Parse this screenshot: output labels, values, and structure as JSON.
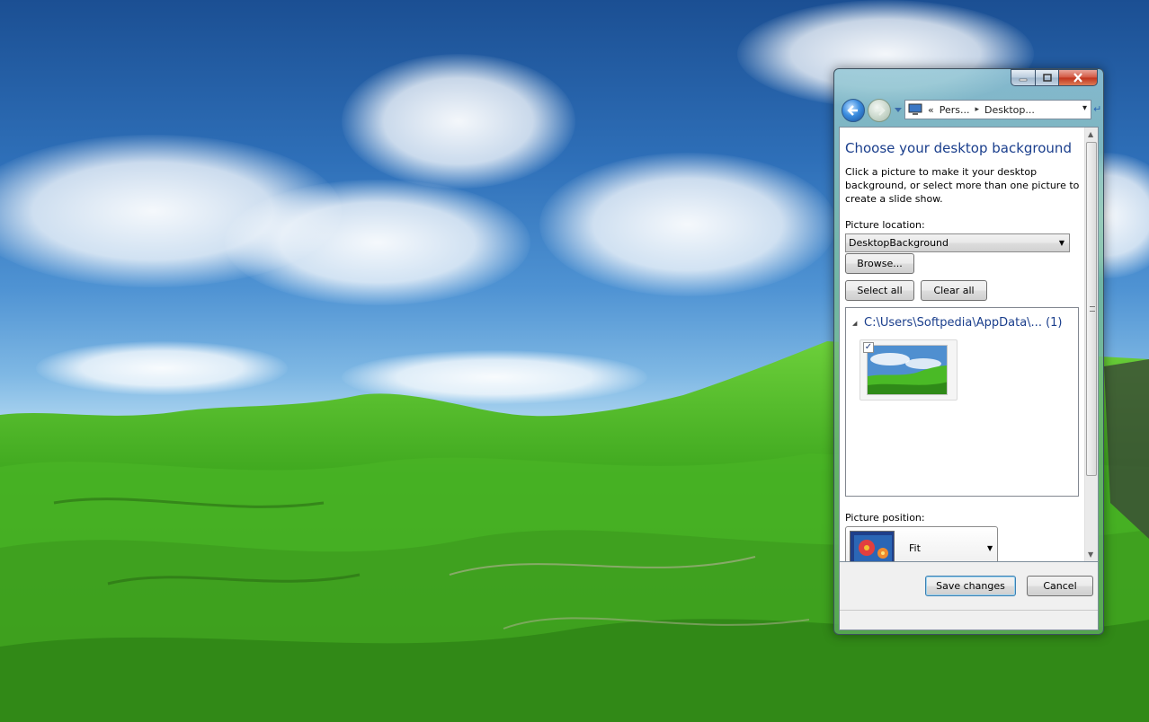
{
  "window": {
    "caption_buttons": [
      "minimize-icon",
      "maximize-icon",
      "close-icon"
    ],
    "address": {
      "icon": "computer-icon",
      "chevrons": "«",
      "crumbs": [
        "Pers...",
        "Desktop..."
      ]
    }
  },
  "content": {
    "title": "Choose your desktop background",
    "description": "Click a picture to make it your desktop background, or select more than one picture to create a slide show.",
    "picture_location_label": "Picture location:",
    "picture_location_value": "DesktopBackground",
    "browse_label": "Browse...",
    "select_all_label": "Select all",
    "clear_all_label": "Clear all",
    "group_header": "C:\\Users\\Softpedia\\AppData\\... (1)",
    "picture_checked": true,
    "picture_position_label": "Picture position:",
    "picture_position_value": "Fit"
  },
  "footer": {
    "save_label": "Save changes",
    "cancel_label": "Cancel"
  },
  "colors": {
    "title_blue": "#1a3e8c",
    "close_red": "#c0331c",
    "wallpaper_grass": "#4fbf2a",
    "wallpaper_sky": "#2e6fb8"
  }
}
